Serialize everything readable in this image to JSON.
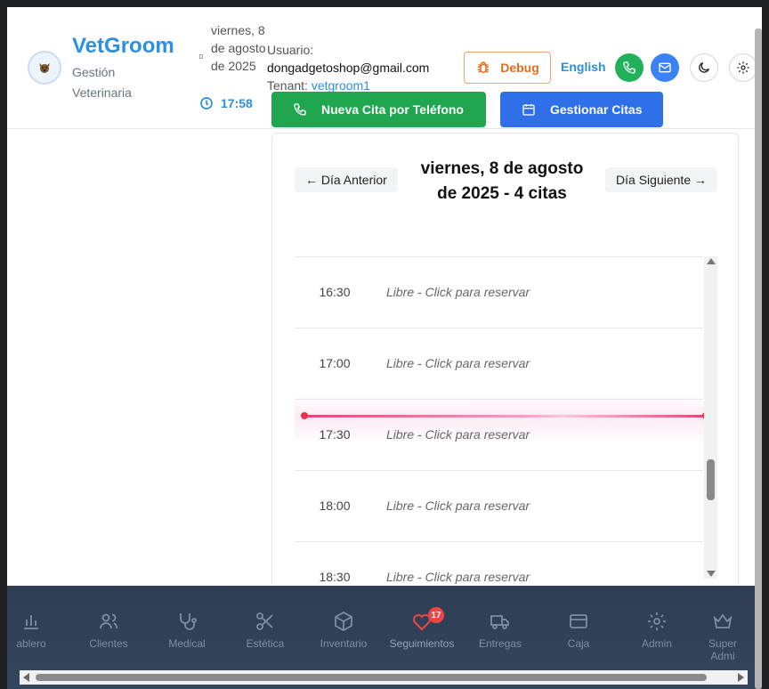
{
  "header": {
    "app_name": "VetGroom",
    "subtitle": "Gestión Veterinaria",
    "date": "viernes, 8 de agosto de 2025",
    "time": "17:58",
    "user_label": "Usuario:",
    "user_email": "dongadgetoshop@gmail.com",
    "tenant_label": "Tenant:",
    "tenant_value": "vetgroom1",
    "debug_label": "Debug",
    "language_label": "English"
  },
  "actions": {
    "new_phone_appointment": "Nueva Cita por Teléfono",
    "manage_appointments": "Gestionar Citas"
  },
  "calendar": {
    "prev_day": "← Día Anterior",
    "next_day": "Día Siguiente →",
    "day_title": "viernes, 8 de agosto de 2025 - 4 citas",
    "slots": [
      {
        "time": "16:30",
        "label": "Libre - Click para reservar"
      },
      {
        "time": "17:00",
        "label": "Libre - Click para reservar"
      },
      {
        "time": "17:30",
        "label": "Libre - Click para reservar"
      },
      {
        "time": "18:00",
        "label": "Libre - Click para reservar"
      },
      {
        "time": "18:30",
        "label": "Libre - Click para reservar"
      }
    ]
  },
  "bottom_nav": {
    "items": [
      {
        "label": "ablero",
        "icon": "bar-chart-icon"
      },
      {
        "label": "Clientes",
        "icon": "users-icon"
      },
      {
        "label": "Medical",
        "icon": "stethoscope-icon"
      },
      {
        "label": "Estética",
        "icon": "scissors-icon"
      },
      {
        "label": "Inventario",
        "icon": "box-icon"
      },
      {
        "label": "Seguimientos",
        "icon": "heart-icon",
        "badge": "17"
      },
      {
        "label": "Entregas",
        "icon": "truck-icon"
      },
      {
        "label": "Caja",
        "icon": "credit-card-icon"
      },
      {
        "label": "Admin",
        "icon": "gear-icon"
      },
      {
        "label": "Super Admi",
        "icon": "crown-icon"
      }
    ]
  },
  "colors": {
    "brand": "#2b8fe6",
    "debug": "#e86a1c",
    "new_appt": "#1fa64f",
    "manage_appt": "#2f6fe8",
    "current_time_line": "#e6457a",
    "nav_bg": "#2e3d52",
    "badge": "#ef4444"
  }
}
